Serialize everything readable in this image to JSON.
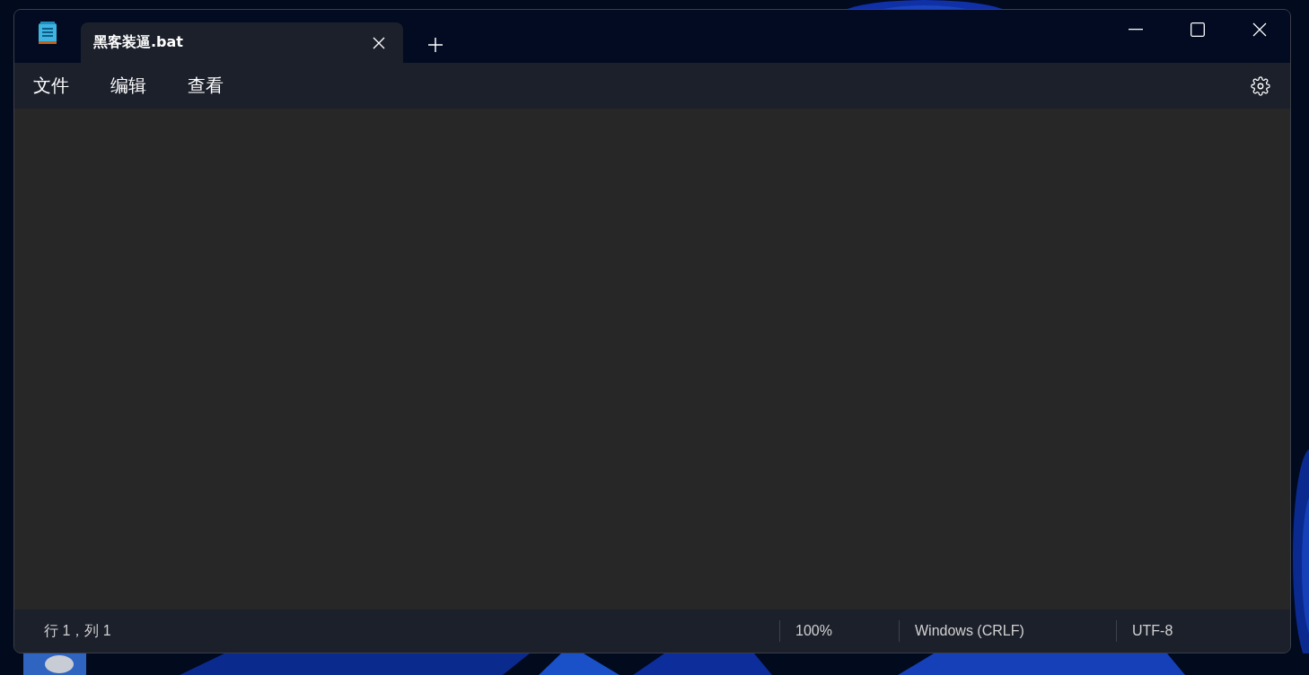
{
  "tabs": [
    {
      "label": "黑客装逼.bat",
      "selected": true
    }
  ],
  "menu": [
    "文件",
    "编辑",
    "查看"
  ],
  "status_bar": {
    "position": "行 1，列 1",
    "zoom": "100%",
    "line_ending": "Windows (CRLF)",
    "encoding": "UTF-8"
  }
}
